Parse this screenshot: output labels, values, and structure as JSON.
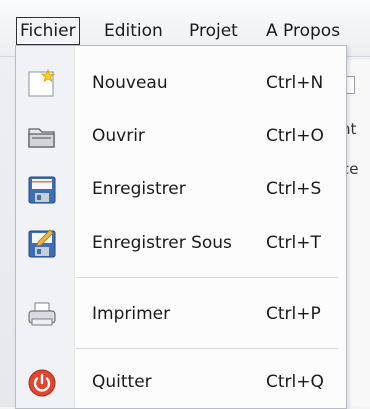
{
  "menubar": {
    "items": [
      {
        "label": "Fichier",
        "active": true
      },
      {
        "label": "Edition",
        "active": false
      },
      {
        "label": "Projet",
        "active": false
      },
      {
        "label": "A Propos",
        "active": false
      }
    ]
  },
  "background": {
    "fragment_1": "nt",
    "fragment_2": "ce"
  },
  "file_menu": {
    "items": [
      {
        "label": "Nouveau",
        "shortcut": "Ctrl+N",
        "icon": "new-document-icon"
      },
      {
        "label": "Ouvrir",
        "shortcut": "Ctrl+O",
        "icon": "open-folder-icon"
      },
      {
        "label": "Enregistrer",
        "shortcut": "Ctrl+S",
        "icon": "floppy-disk-icon"
      },
      {
        "label": "Enregistrer Sous",
        "shortcut": "Ctrl+T",
        "icon": "floppy-disk-edit-icon"
      },
      {
        "label": "Imprimer",
        "shortcut": "Ctrl+P",
        "icon": "printer-icon"
      },
      {
        "label": "Quitter",
        "shortcut": "Ctrl+Q",
        "icon": "power-icon"
      }
    ]
  }
}
